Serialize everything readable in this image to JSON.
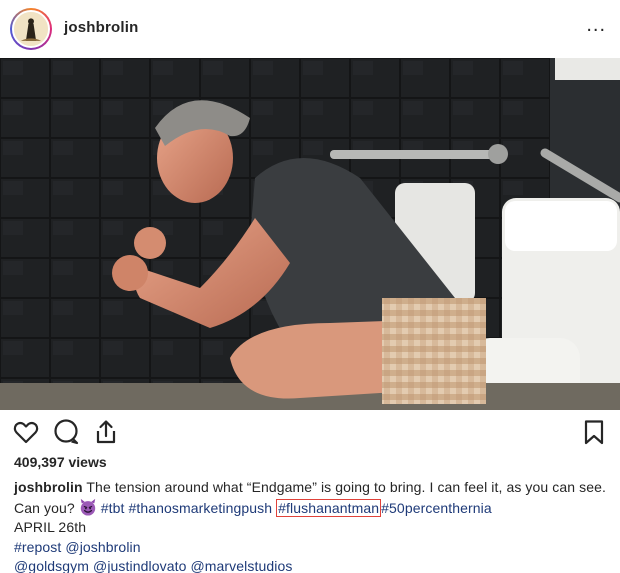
{
  "post": {
    "username": "joshbrolin",
    "more_label": "...",
    "views": "409,397 views",
    "caption": {
      "author": "joshbrolin",
      "text_1": " The tension around what “Endgame” is going to bring. I can feel it, as you can see. Can you? ",
      "emoji": "smiling-devil-emoji",
      "tags_line": [
        " #tbt",
        " #thanosmarketingpush",
        "#flushanantman",
        "#50percenthernia"
      ],
      "date_line": "APRIL 26th",
      "repost_line": "#repost @joshbrolin",
      "mentions_line": "@goldsgym @justindlovato @marvelstudios"
    }
  },
  "icons": {
    "like": "heart-icon",
    "comment": "comment-icon",
    "share": "share-icon",
    "save": "bookmark-icon"
  },
  "colors": {
    "text": "#262626",
    "hashtag": "#1e3a78",
    "highlight_box": "#e0423a"
  }
}
